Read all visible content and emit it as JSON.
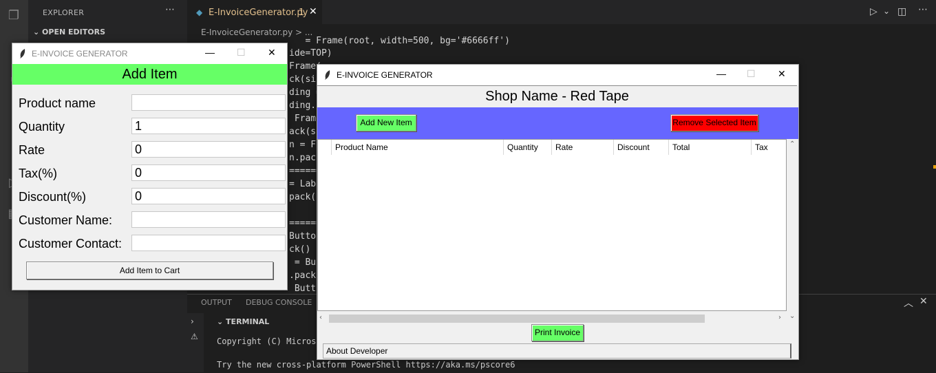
{
  "vscode": {
    "explorer_title": "EXPLORER",
    "open_editors": "OPEN EDITORS",
    "tab_file": "E-InvoiceGenerator.py",
    "tab_badge": "1",
    "breadcrumb": "E-InvoiceGenerator.py > ...",
    "code_lines": [
      "   = Frame(root, width=500, bg='#6666ff')",
      "ide=TOP)",
      "Frame(",
      "ck(sid",
      "ding =",
      "ding.pa",
      " Frame",
      "ack(si",
      "n = Fr",
      "n.pack",
      "======",
      "= Labe",
      "pack(f",
      "",
      "======",
      "Button",
      "ck()",
      " = But",
      ".pack(",
      " Butto"
    ],
    "panel_tabs": [
      "OUTPUT",
      "DEBUG CONSOLE"
    ],
    "terminal_title": "TERMINAL",
    "terminal_lines": [
      "Copyright (C) Micros",
      "",
      "Try the new cross-platform PowerShell https://aka.ms/pscore6"
    ]
  },
  "add_window": {
    "title": "E-INVOICE GENERATOR",
    "header": "Add Item",
    "fields": [
      {
        "label": "Product name",
        "value": ""
      },
      {
        "label": "Quantity",
        "value": "1"
      },
      {
        "label": "Rate",
        "value": "0"
      },
      {
        "label": "Tax(%)",
        "value": "0"
      },
      {
        "label": "Discount(%)",
        "value": "0"
      },
      {
        "label": "Customer Name:",
        "value": ""
      },
      {
        "label": "Customer Contact:",
        "value": ""
      }
    ],
    "add_button": "Add Item to Cart"
  },
  "invoice_window": {
    "title": "E-INVOICE GENERATOR",
    "shop_name": "Shop Name - Red Tape",
    "add_new_item": "Add New Item",
    "remove_item": "Remove Selected Item",
    "columns": [
      "Product Name",
      "Quantity",
      "Rate",
      "Discount",
      "Total",
      "Tax"
    ],
    "print_invoice": "Print Invoice",
    "about": "About Developer"
  },
  "colors": {
    "green": "#66ff66",
    "blue": "#6666ff",
    "red": "#ff0000"
  }
}
